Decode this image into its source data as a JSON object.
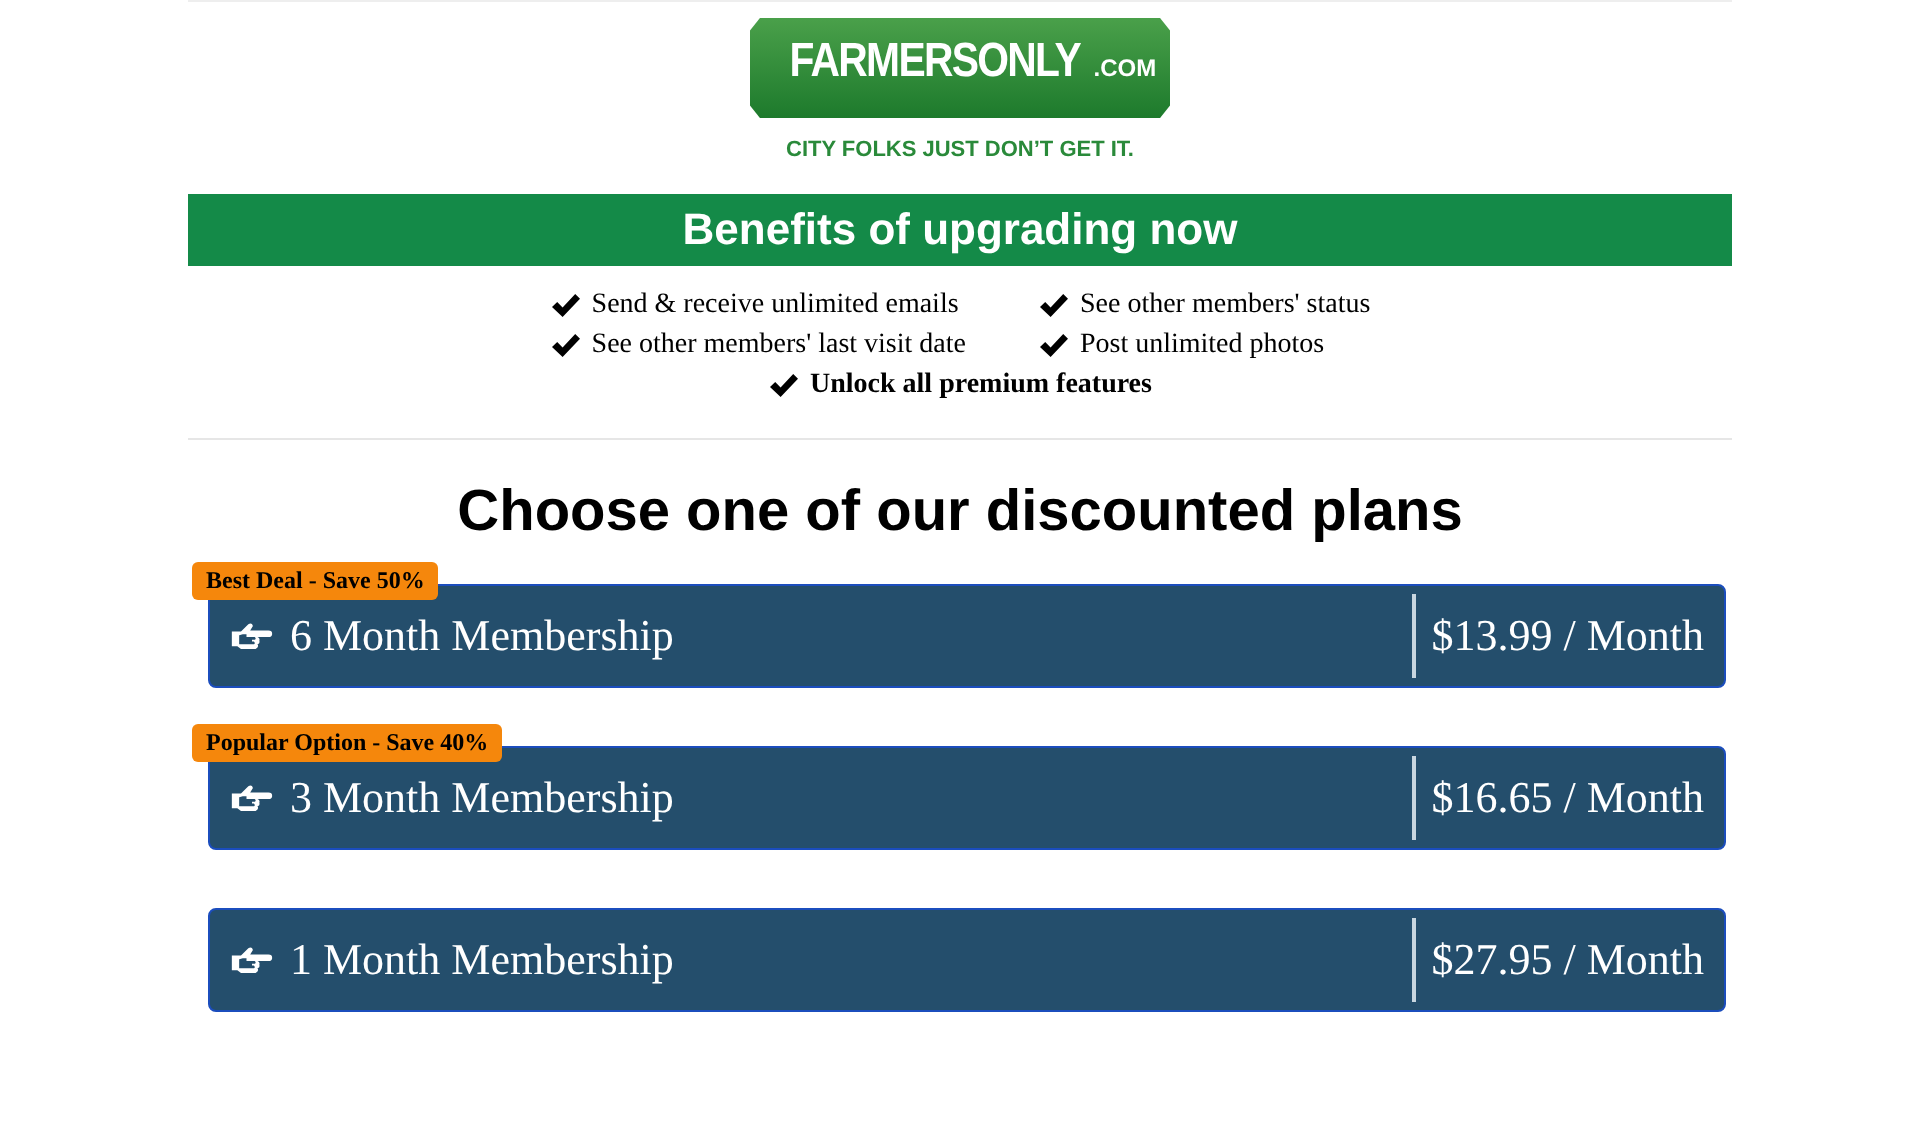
{
  "logo": {
    "name": "FARMERSONLY",
    "suffix": ".COM",
    "tagline": "CITY FOLKS JUST DON’T GET IT."
  },
  "benefits": {
    "title": "Benefits of upgrading now",
    "items": [
      {
        "text": "Send & receive unlimited emails",
        "bold": false
      },
      {
        "text": "See other members' status",
        "bold": false
      },
      {
        "text": "See other members' last visit date",
        "bold": false
      },
      {
        "text": "Post unlimited photos",
        "bold": false
      },
      {
        "text": "Unlock all premium features",
        "bold": true
      }
    ]
  },
  "plans": {
    "title": "Choose one of our discounted plans",
    "items": [
      {
        "badge": "Best Deal - Save 50%",
        "name": "6 Month Membership",
        "price": "$13.99 / Month"
      },
      {
        "badge": "Popular Option - Save 40%",
        "name": "3 Month Membership",
        "price": "$16.65 / Month"
      },
      {
        "name": "1 Month Membership",
        "price": "$27.95 / Month"
      }
    ]
  }
}
